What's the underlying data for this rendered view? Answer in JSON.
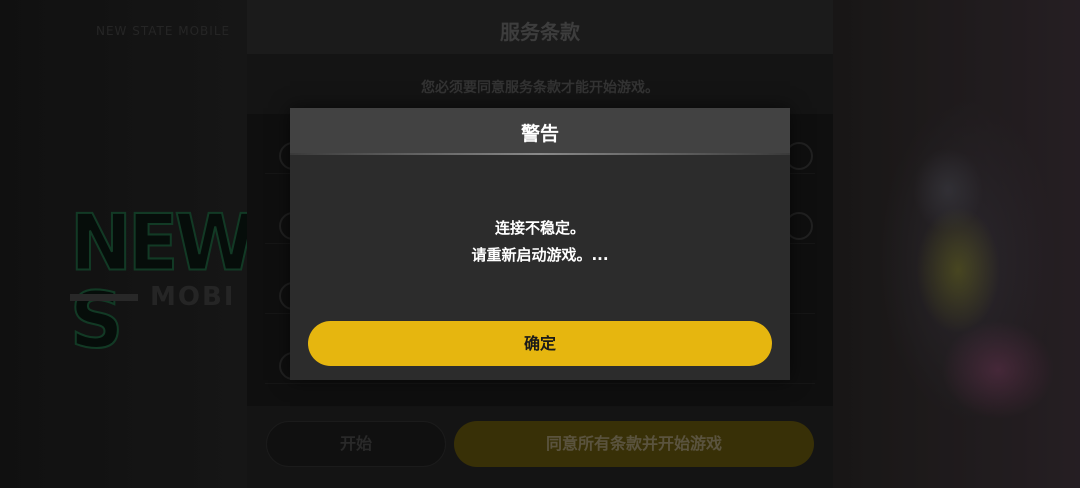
{
  "background": {
    "top_text": "NEW STATE MOBILE",
    "logo_main": "NEW S",
    "logo_sub": "MOBI"
  },
  "terms_panel": {
    "title": "服务条款",
    "subtitle": "您必须要同意服务条款才能开始游戏。",
    "start_button_label": "开始",
    "agree_all_button_label": "同意所有条款并开始游戏"
  },
  "dialog": {
    "title": "警告",
    "message_line1": "连接不稳定。",
    "message_line2": "请重新启动游戏。...",
    "confirm_label": "确定"
  },
  "colors": {
    "accent": "#e6b60f",
    "dialog_bg": "#2c2c2c",
    "dialog_header": "#424242"
  }
}
